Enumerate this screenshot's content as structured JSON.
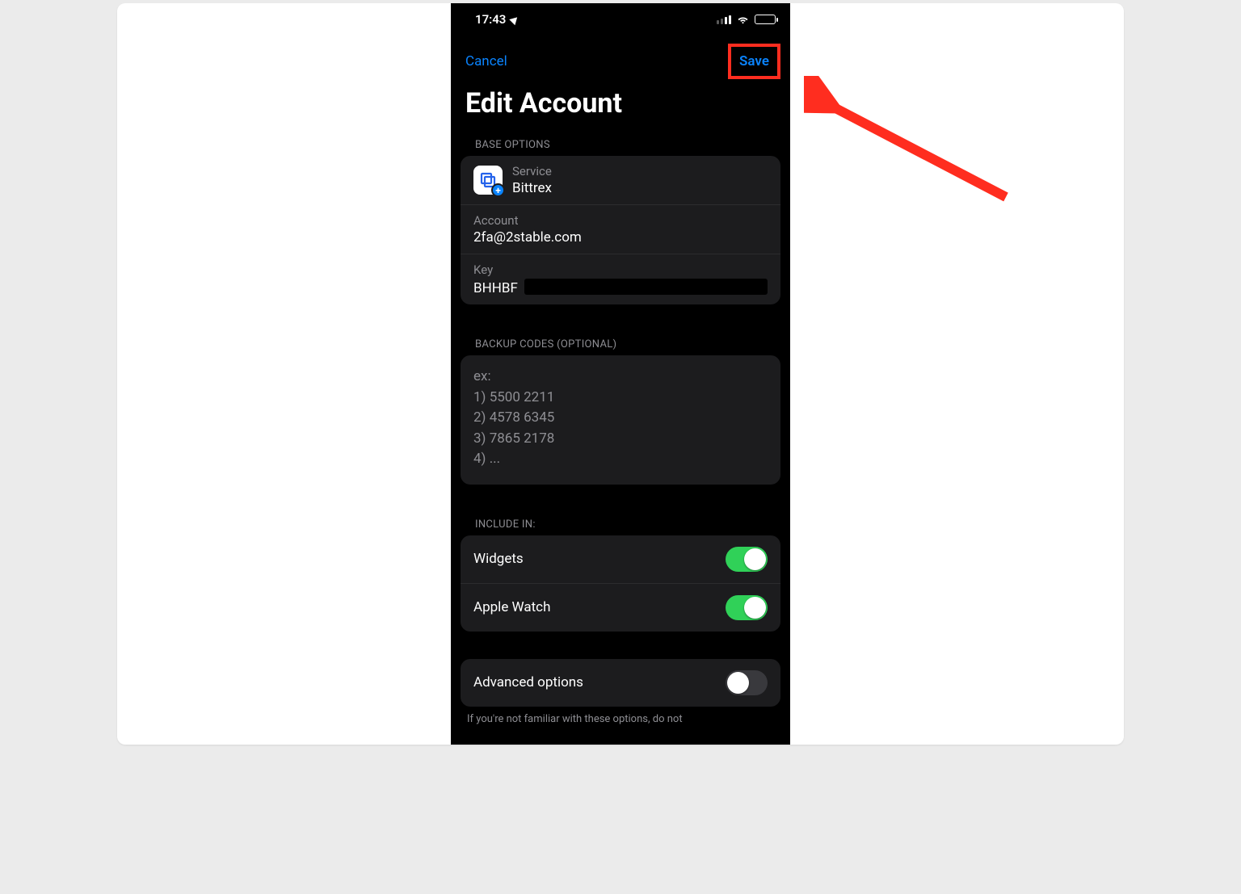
{
  "status_bar": {
    "time": "17:43"
  },
  "nav": {
    "cancel_label": "Cancel",
    "save_label": "Save"
  },
  "title": "Edit Account",
  "sections": {
    "base_options_header": "BASE OPTIONS",
    "service_label": "Service",
    "service_value": "Bittrex",
    "account_label": "Account",
    "account_value": "2fa@2stable.com",
    "key_label": "Key",
    "key_value": "BHHBF",
    "backup_header": "BACKUP CODES (OPTIONAL)",
    "backup_placeholder": "ex:\n1) 5500 2211\n2) 4578 6345\n3) 7865 2178\n4) ...",
    "include_in_header": "INCLUDE IN:",
    "widgets_label": "Widgets",
    "apple_watch_label": "Apple Watch",
    "advanced_label": "Advanced options",
    "advanced_footer": "If you're not familiar with these options, do not"
  },
  "annotation": {
    "color": "#ff2d1f"
  }
}
